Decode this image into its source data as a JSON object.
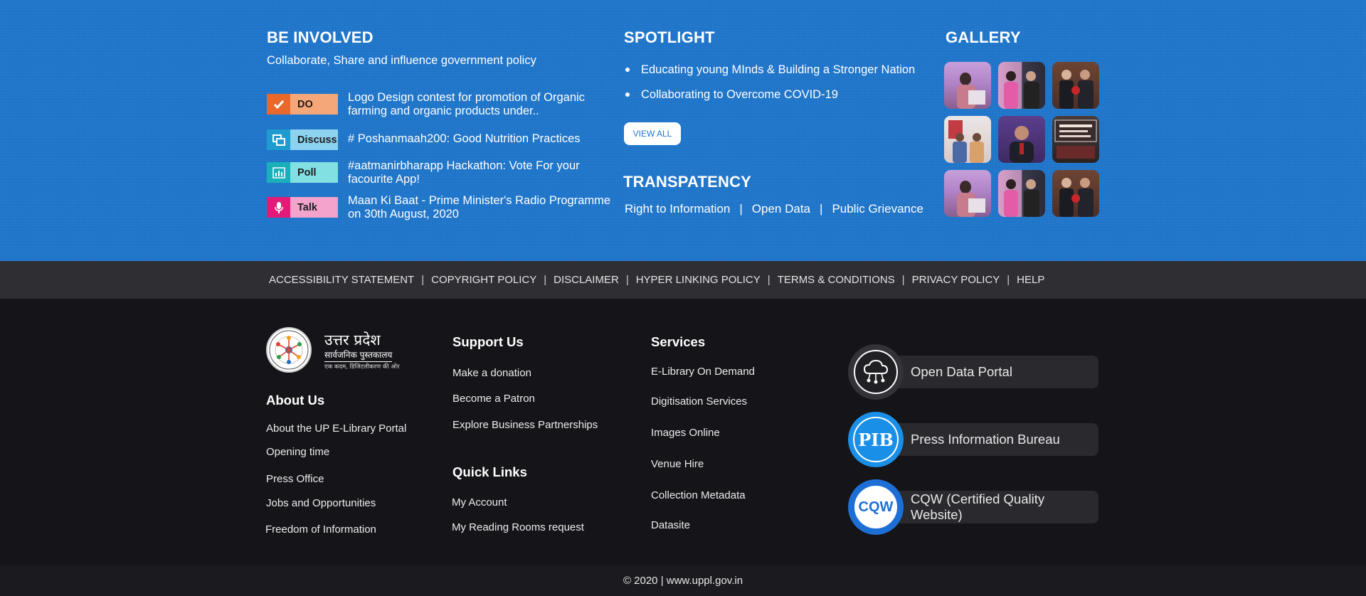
{
  "be_involved": {
    "title": "BE INVOLVED",
    "subtitle": "Collaborate, Share and influence government policy",
    "items": [
      {
        "badge": "DO",
        "text": "Logo Design contest for promotion of Organic farming and organic products under..",
        "icon": "check-icon",
        "icon_color": "#e8692b",
        "badge_color": "#f6a77a"
      },
      {
        "badge": "Discuss",
        "text": "# Poshanmaah200: Good Nutrition Practices",
        "icon": "chat-icon",
        "icon_color": "#1e9ccf",
        "badge_color": "#8dd3f0"
      },
      {
        "badge": "Poll",
        "text": "#aatmanirbharapp Hackathon: Vote For your facourite App!",
        "icon": "bar-chart-icon",
        "icon_color": "#19b0b9",
        "badge_color": "#82e0e3"
      },
      {
        "badge": "Talk",
        "text": "Maan Ki Baat - Prime Minister's Radio Programme on 30th August, 2020",
        "icon": "microphone-icon",
        "icon_color": "#e31b78",
        "badge_color": "#f4a3cc"
      }
    ]
  },
  "spotlight": {
    "title": "SPOTLIGHT",
    "items": [
      "Educating young MInds & Building a Stronger Nation",
      "Collaborating to Overcome COVID-19"
    ],
    "view_all": "VIEW ALL"
  },
  "transparency": {
    "title": "TRANSPATENCY",
    "links": [
      "Right to Information",
      "Open Data",
      "Public Grievance"
    ],
    "separator": "|"
  },
  "gallery": {
    "title": "GALLERY",
    "count": 9
  },
  "policy_bar": {
    "links": [
      "ACCESSIBILITY STATEMENT",
      "COPYRIGHT POLICY",
      "DISCLAIMER",
      "HYPER LINKING POLICY",
      "TERMS & CONDITIONS",
      "PRIVACY POLICY",
      "HELP"
    ],
    "separator": "|"
  },
  "logo": {
    "title": "उत्तर प्रदेश",
    "subtitle": "सार्वजनिक पुस्तकालय",
    "tagline": "एक कदम, डिजिटलीकरण की ओर"
  },
  "about": {
    "title": "About Us",
    "links": [
      "About the UP E-Library Portal",
      "Opening time",
      "Press Office",
      "Jobs and Opportunities",
      "Freedom of Information"
    ]
  },
  "support": {
    "title": "Support Us",
    "links": [
      "Make a donation",
      "Become a Patron",
      "Explore Business Partnerships"
    ]
  },
  "quick_links": {
    "title": "Quick Links",
    "links": [
      "My Account",
      "My Reading Rooms request"
    ]
  },
  "services": {
    "title": "Services",
    "links": [
      "E-Library On Demand",
      "Digitisation Services",
      "Images Online",
      "Venue Hire",
      "Collection Metadata",
      "Datasite"
    ]
  },
  "portals": [
    {
      "label": "Open Data Portal",
      "icon": "cloud-network-icon"
    },
    {
      "label": "Press Information Bureau",
      "icon": "pib-logo",
      "logo_text": "PIB"
    },
    {
      "label": "CQW (Certified Quality Website)",
      "icon": "cqw-logo",
      "logo_text": "CQW"
    }
  ],
  "copyright": "© 2020 | www.uppl.gov.in"
}
